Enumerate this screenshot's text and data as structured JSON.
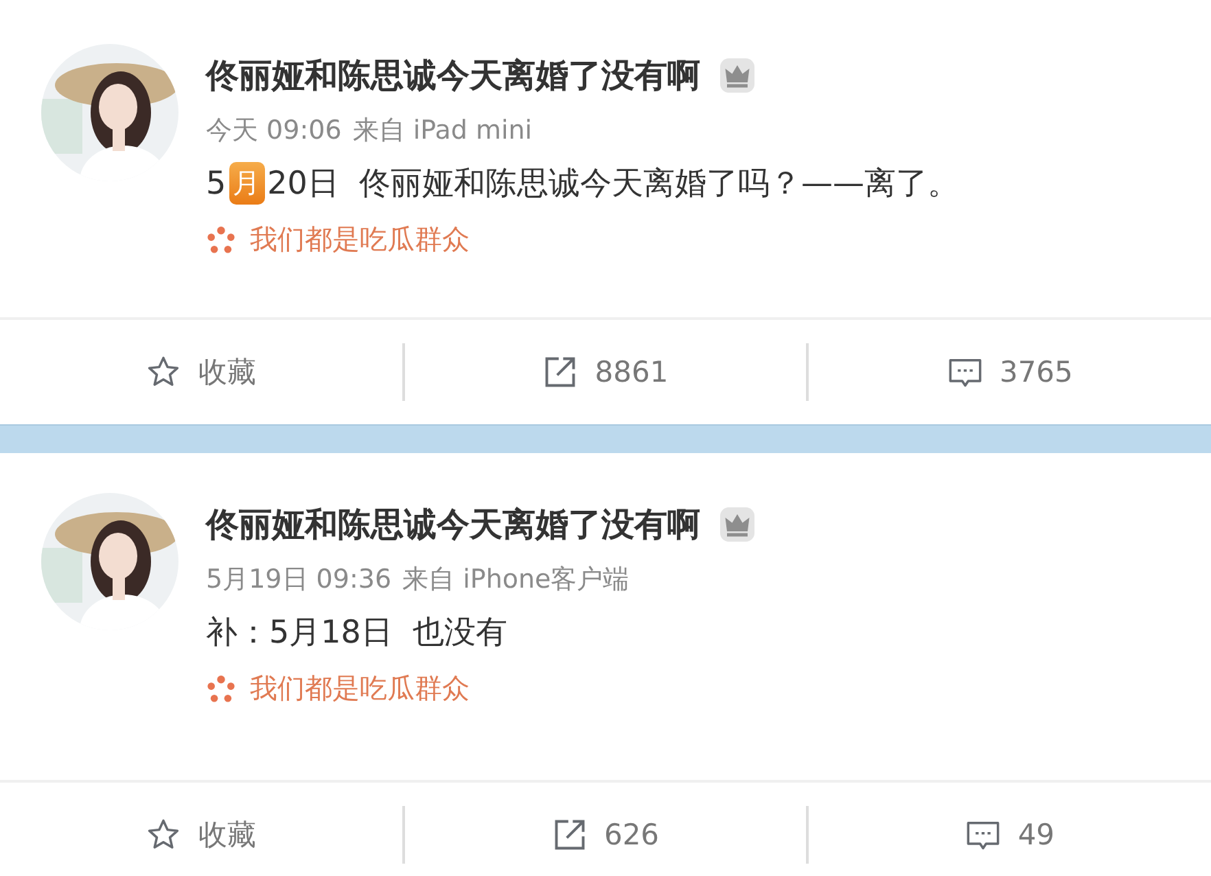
{
  "posts": [
    {
      "author": "佟丽娅和陈思诚今天离婚了没有啊",
      "time": "今天 09:06",
      "source": "来自 iPad mini",
      "content": [
        {
          "kind": "text",
          "text": "5"
        },
        {
          "kind": "emoji",
          "text": "月"
        },
        {
          "kind": "text",
          "text": "20日  佟丽娅和陈思诚今天离婚了吗？——离了。"
        }
      ],
      "topic": "我们都是吃瓜群众",
      "actions": [
        {
          "kind": "favorite",
          "label": "收藏"
        },
        {
          "kind": "repost",
          "label": "8861"
        },
        {
          "kind": "comment",
          "label": "3765"
        }
      ]
    },
    {
      "author": "佟丽娅和陈思诚今天离婚了没有啊",
      "time": "5月19日 09:36",
      "source": "来自 iPhone客户端",
      "content": [
        {
          "kind": "text",
          "text": "补：5月18日  也没有"
        }
      ],
      "topic": "我们都是吃瓜群众",
      "actions": [
        {
          "kind": "favorite",
          "label": "收藏"
        },
        {
          "kind": "repost",
          "label": "626"
        },
        {
          "kind": "comment",
          "label": "49"
        }
      ]
    }
  ]
}
